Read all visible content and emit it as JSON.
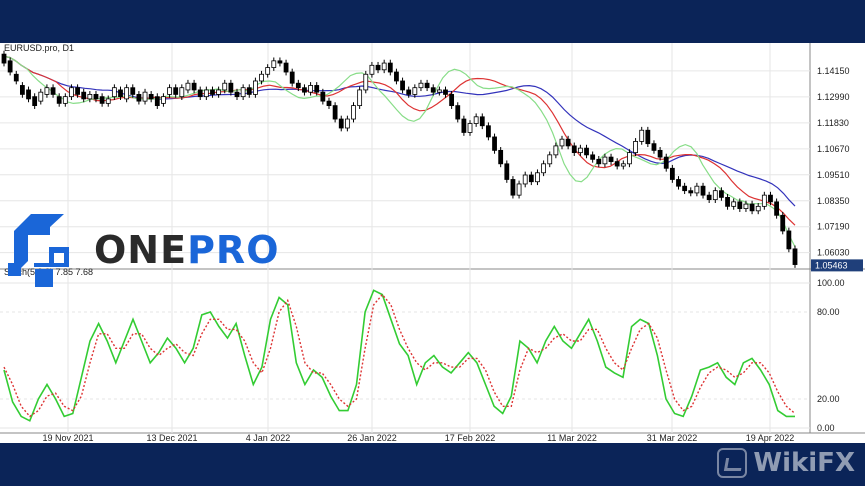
{
  "chart_data": [
    {
      "type": "candlestick",
      "title": "EURUSD.pro, D1",
      "ylim": [
        1.0548,
        1.1495
      ],
      "yticks": [
        "1.14150",
        "1.12990",
        "1.11830",
        "1.10670",
        "1.09510",
        "1.08350",
        "1.07190",
        "1.06030"
      ],
      "last_price": "1.05463",
      "xticks": [
        "19 Nov 2021",
        "13 Dec 2021",
        "4 Jan 2022",
        "26 Jan 2022",
        "17 Feb 2022",
        "11 Mar 2022",
        "31 Mar 2022",
        "19 Apr 2022"
      ],
      "grid": true,
      "moving_averages": [
        {
          "color": "#3333bb",
          "start": 1.148,
          "end": 1.091
        },
        {
          "color": "#dd3333",
          "start": 1.147,
          "end": 1.083
        },
        {
          "color": "#88dd88",
          "start": 1.147,
          "end": 1.072
        }
      ],
      "series_close": [
        1.148,
        1.147,
        1.143,
        1.138,
        1.136,
        1.133,
        1.135,
        1.132,
        1.129,
        1.126,
        1.125,
        1.126,
        1.129,
        1.13,
        1.129,
        1.13,
        1.127,
        1.13,
        1.132,
        1.129,
        1.131,
        1.13,
        1.128,
        1.127,
        1.129,
        1.13,
        1.131,
        1.129,
        1.132,
        1.128,
        1.129,
        1.132,
        1.133,
        1.136,
        1.133,
        1.131,
        1.132,
        1.135,
        1.133,
        1.13,
        1.133,
        1.135,
        1.132,
        1.138,
        1.14,
        1.139,
        1.136,
        1.13,
        1.128,
        1.13,
        1.131,
        1.129,
        1.128,
        1.13,
        1.133,
        1.131,
        1.133,
        1.136,
        1.14,
        1.145,
        1.143,
        1.138,
        1.137,
        1.133,
        1.129,
        1.127,
        1.125,
        1.122,
        1.118,
        1.115,
        1.118,
        1.122,
        1.128,
        1.135,
        1.141,
        1.143,
        1.145,
        1.142,
        1.14,
        1.138,
        1.135,
        1.132,
        1.13,
        1.134,
        1.137,
        1.136,
        1.134,
        1.132,
        1.133,
        1.131,
        1.128,
        1.125,
        1.12,
        1.115,
        1.11,
        1.1,
        1.09,
        1.085,
        1.092,
        1.095,
        1.098,
        1.1,
        1.105,
        1.11,
        1.108,
        1.106,
        1.105,
        1.104,
        1.102,
        1.1,
        1.101,
        1.099,
        1.098,
        1.1,
        1.105,
        1.11,
        1.115,
        1.108,
        1.105,
        1.1,
        1.095,
        1.09,
        1.088,
        1.085,
        1.087,
        1.084,
        1.083,
        1.08,
        1.083,
        1.08,
        1.085,
        1.083,
        1.08,
        1.075,
        1.07,
        1.06,
        1.055,
        1.0546
      ],
      "candles": [
        [
          1.149,
          1.145
        ],
        [
          1.146,
          1.141
        ],
        [
          1.14,
          1.137
        ],
        [
          1.135,
          1.131
        ],
        [
          1.133,
          1.129
        ],
        [
          1.13,
          1.126
        ],
        [
          1.128,
          1.132
        ],
        [
          1.131,
          1.134
        ],
        [
          1.134,
          1.131
        ],
        [
          1.13,
          1.127
        ],
        [
          1.127,
          1.13
        ],
        [
          1.13,
          1.134
        ],
        [
          1.134,
          1.131
        ],
        [
          1.132,
          1.129
        ],
        [
          1.129,
          1.131
        ],
        [
          1.131,
          1.129
        ],
        [
          1.13,
          1.127
        ],
        [
          1.127,
          1.129
        ],
        [
          1.13,
          1.134
        ],
        [
          1.133,
          1.13
        ],
        [
          1.129,
          1.134
        ],
        [
          1.134,
          1.131
        ],
        [
          1.131,
          1.128
        ],
        [
          1.128,
          1.132
        ],
        [
          1.131,
          1.129
        ],
        [
          1.13,
          1.126
        ],
        [
          1.127,
          1.13
        ],
        [
          1.131,
          1.134
        ],
        [
          1.134,
          1.131
        ],
        [
          1.13,
          1.134
        ],
        [
          1.133,
          1.136
        ],
        [
          1.136,
          1.133
        ],
        [
          1.133,
          1.13
        ],
        [
          1.13,
          1.133
        ],
        [
          1.133,
          1.131
        ],
        [
          1.131,
          1.133
        ],
        [
          1.133,
          1.136
        ],
        [
          1.136,
          1.132
        ],
        [
          1.132,
          1.13
        ],
        [
          1.13,
          1.134
        ],
        [
          1.134,
          1.131
        ],
        [
          1.131,
          1.137
        ],
        [
          1.137,
          1.14
        ],
        [
          1.14,
          1.143
        ],
        [
          1.143,
          1.146
        ],
        [
          1.146,
          1.145
        ],
        [
          1.145,
          1.141
        ],
        [
          1.141,
          1.136
        ],
        [
          1.136,
          1.134
        ],
        [
          1.134,
          1.132
        ],
        [
          1.132,
          1.135
        ],
        [
          1.135,
          1.132
        ],
        [
          1.132,
          1.128
        ],
        [
          1.128,
          1.126
        ],
        [
          1.126,
          1.12
        ],
        [
          1.12,
          1.116
        ],
        [
          1.116,
          1.12
        ],
        [
          1.12,
          1.126
        ],
        [
          1.126,
          1.133
        ],
        [
          1.133,
          1.14
        ],
        [
          1.14,
          1.144
        ],
        [
          1.144,
          1.142
        ],
        [
          1.142,
          1.145
        ],
        [
          1.145,
          1.141
        ],
        [
          1.141,
          1.137
        ],
        [
          1.137,
          1.133
        ],
        [
          1.133,
          1.131
        ],
        [
          1.131,
          1.134
        ],
        [
          1.134,
          1.136
        ],
        [
          1.136,
          1.134
        ],
        [
          1.134,
          1.132
        ],
        [
          1.132,
          1.133
        ],
        [
          1.133,
          1.131
        ],
        [
          1.131,
          1.126
        ],
        [
          1.126,
          1.12
        ],
        [
          1.12,
          1.114
        ],
        [
          1.114,
          1.118
        ],
        [
          1.118,
          1.121
        ],
        [
          1.121,
          1.117
        ],
        [
          1.117,
          1.112
        ],
        [
          1.112,
          1.106
        ],
        [
          1.106,
          1.1
        ],
        [
          1.1,
          1.093
        ],
        [
          1.093,
          1.086
        ],
        [
          1.086,
          1.091
        ],
        [
          1.091,
          1.095
        ],
        [
          1.095,
          1.092
        ],
        [
          1.092,
          1.096
        ],
        [
          1.096,
          1.1
        ],
        [
          1.1,
          1.104
        ],
        [
          1.104,
          1.108
        ],
        [
          1.108,
          1.111
        ],
        [
          1.111,
          1.108
        ],
        [
          1.108,
          1.105
        ],
        [
          1.105,
          1.107
        ],
        [
          1.107,
          1.104
        ],
        [
          1.104,
          1.102
        ],
        [
          1.102,
          1.1
        ],
        [
          1.1,
          1.103
        ],
        [
          1.103,
          1.101
        ],
        [
          1.101,
          1.099
        ],
        [
          1.099,
          1.1
        ],
        [
          1.1,
          1.105
        ],
        [
          1.105,
          1.11
        ],
        [
          1.11,
          1.115
        ],
        [
          1.115,
          1.109
        ],
        [
          1.109,
          1.106
        ],
        [
          1.106,
          1.103
        ],
        [
          1.103,
          1.098
        ],
        [
          1.098,
          1.093
        ],
        [
          1.093,
          1.09
        ],
        [
          1.09,
          1.088
        ],
        [
          1.088,
          1.087
        ],
        [
          1.087,
          1.09
        ],
        [
          1.09,
          1.086
        ],
        [
          1.086,
          1.084
        ],
        [
          1.084,
          1.088
        ],
        [
          1.088,
          1.085
        ],
        [
          1.085,
          1.081
        ],
        [
          1.081,
          1.083
        ],
        [
          1.083,
          1.08
        ],
        [
          1.08,
          1.082
        ],
        [
          1.082,
          1.079
        ],
        [
          1.079,
          1.081
        ],
        [
          1.081,
          1.086
        ],
        [
          1.086,
          1.083
        ],
        [
          1.083,
          1.077
        ],
        [
          1.077,
          1.07
        ],
        [
          1.07,
          1.062
        ],
        [
          1.062,
          1.055
        ]
      ]
    },
    {
      "type": "line",
      "title": "Stoch(5,3,3) 7.85 7.68",
      "ylim": [
        0,
        100
      ],
      "yticks": [
        "100.00",
        "80.00",
        "20.00",
        "0.00"
      ],
      "series": [
        {
          "name": "",
          "color": "#33cc33",
          "values": [
            40,
            18,
            8,
            5,
            20,
            30,
            20,
            8,
            10,
            35,
            60,
            72,
            60,
            45,
            60,
            75,
            60,
            45,
            52,
            62,
            55,
            45,
            55,
            78,
            80,
            70,
            62,
            72,
            50,
            30,
            42,
            75,
            90,
            85,
            45,
            30,
            40,
            35,
            22,
            12,
            12,
            30,
            80,
            95,
            92,
            75,
            58,
            50,
            30,
            45,
            50,
            42,
            38,
            45,
            52,
            45,
            30,
            15,
            10,
            22,
            60,
            55,
            45,
            60,
            70,
            60,
            55,
            65,
            75,
            60,
            42,
            38,
            35,
            70,
            75,
            72,
            50,
            20,
            10,
            8,
            22,
            40,
            42,
            45,
            35,
            30,
            45,
            48,
            40,
            30,
            12,
            8,
            8
          ]
        },
        {
          "name": "",
          "color": "#dd3333",
          "values": [
            42,
            30,
            15,
            8,
            12,
            22,
            24,
            15,
            12,
            22,
            45,
            65,
            65,
            55,
            55,
            65,
            65,
            55,
            50,
            55,
            58,
            52,
            50,
            65,
            75,
            75,
            68,
            68,
            60,
            45,
            38,
            55,
            80,
            88,
            70,
            45,
            38,
            38,
            30,
            20,
            15,
            20,
            55,
            85,
            92,
            85,
            68,
            55,
            45,
            40,
            45,
            45,
            42,
            42,
            48,
            48,
            40,
            25,
            15,
            15,
            40,
            55,
            52,
            55,
            62,
            65,
            60,
            60,
            68,
            68,
            55,
            45,
            40,
            55,
            68,
            72,
            62,
            40,
            20,
            12,
            15,
            28,
            38,
            42,
            40,
            35,
            38,
            45,
            45,
            38,
            25,
            15,
            10
          ]
        }
      ]
    }
  ],
  "logo": {
    "part1": "ONE",
    "part2": "PRO"
  },
  "watermark": "WikiFX",
  "colors": {
    "bull": "#ffffff",
    "bear": "#000000",
    "grid": "#e6e6e6",
    "price_box": "#1f3f7a",
    "logo_blue": "#1a66d8",
    "logo_dark": "#2a2a2a",
    "frame": "#0b2458"
  }
}
